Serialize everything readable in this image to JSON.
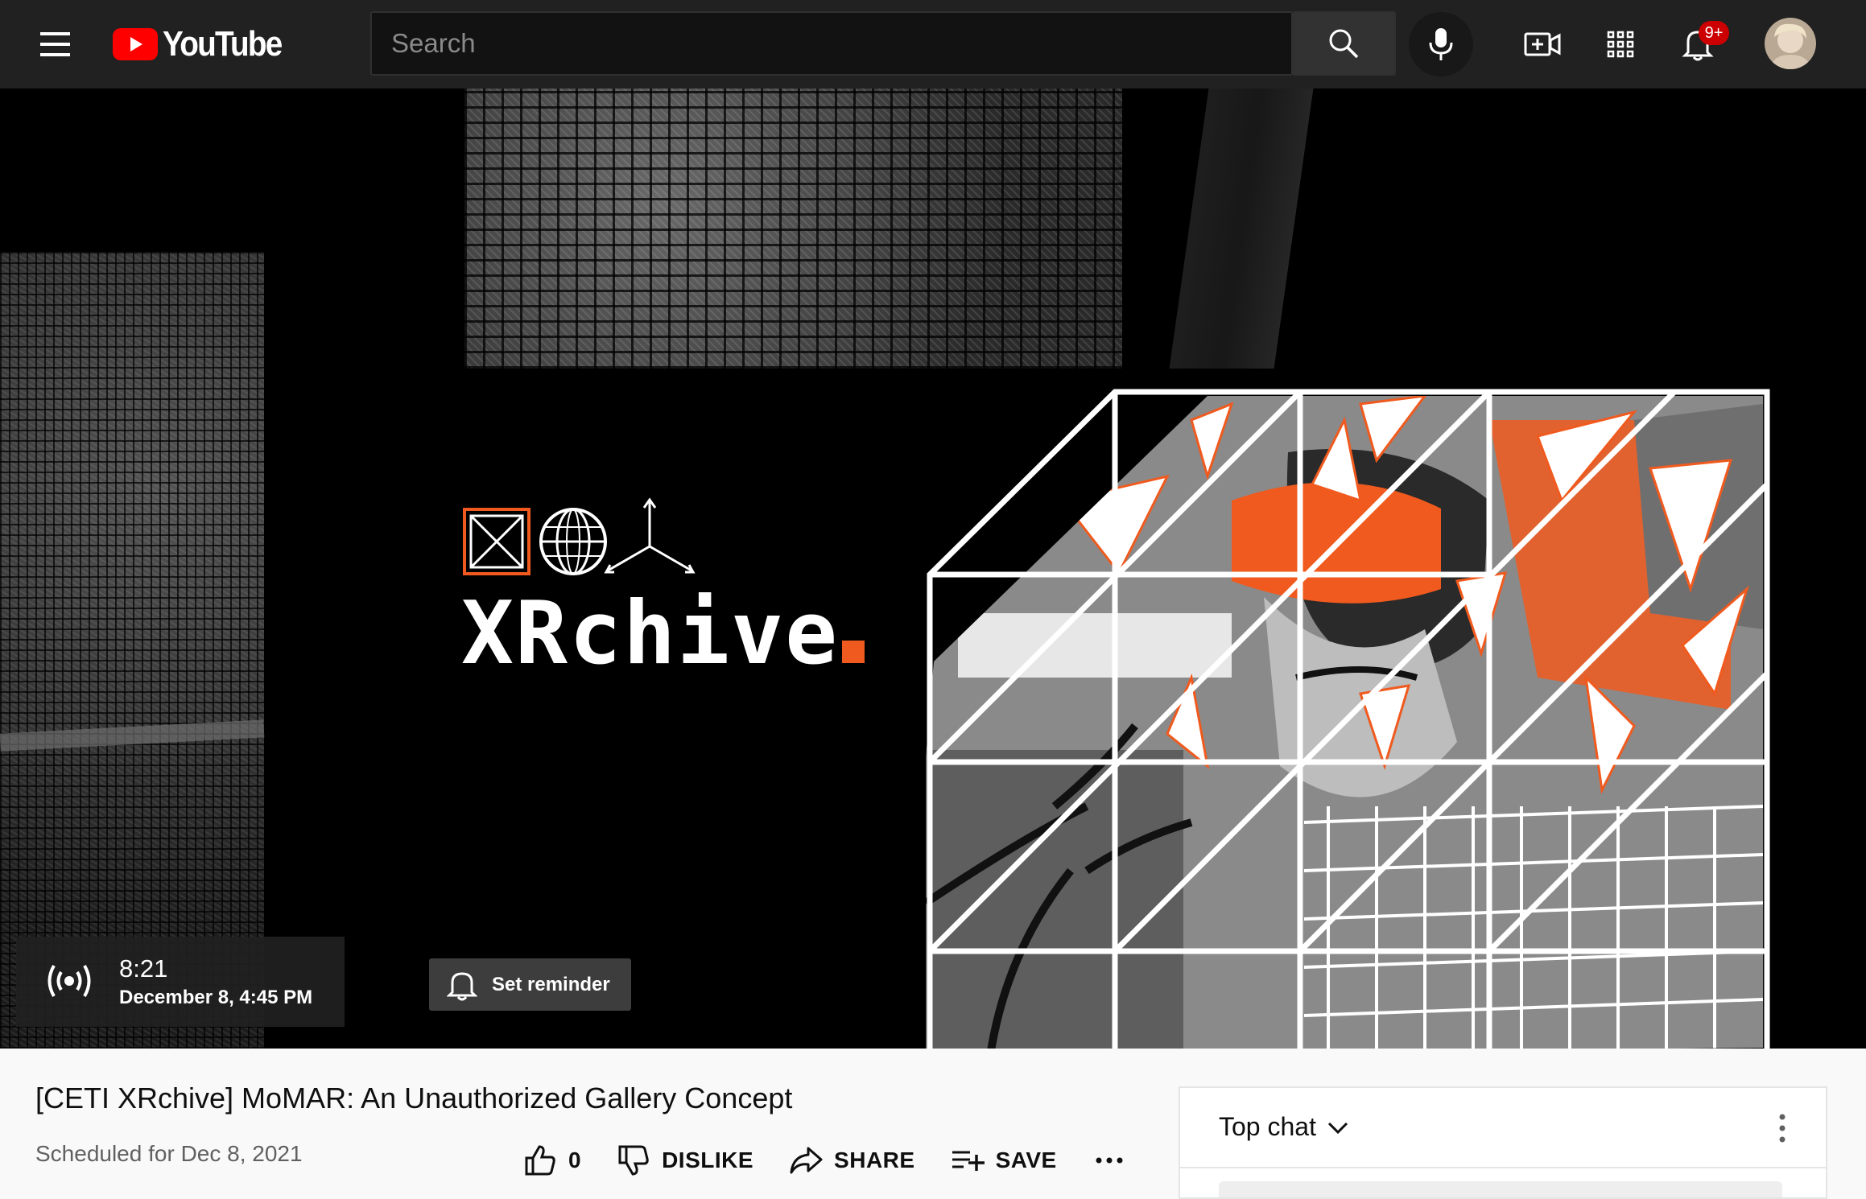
{
  "header": {
    "logo_text": "YouTube",
    "search_placeholder": "Search",
    "notifications_badge": "9+"
  },
  "icons": {
    "menu": "hamburger-menu-icon",
    "search": "search-icon",
    "mic": "microphone-icon",
    "create": "video-camera-plus-icon",
    "apps": "apps-grid-icon",
    "notifications": "bell-icon",
    "live": "live-broadcast-icon",
    "like": "thumbs-up-icon",
    "dislike": "thumbs-down-icon",
    "share": "share-arrow-icon",
    "save": "playlist-add-icon",
    "more": "more-horizontal-icon"
  },
  "video": {
    "artwork_title": "XRchive",
    "live_time": "8:21",
    "live_date": "December 8, 4:45 PM",
    "reminder_label": "Set reminder"
  },
  "details": {
    "title": "[CETI XRchive] MoMAR: An Unauthorized Gallery Concept",
    "scheduled": "Scheduled for Dec 8, 2021",
    "like_count": "0",
    "dislike_label": "DISLIKE",
    "share_label": "SHARE",
    "save_label": "SAVE"
  },
  "chat": {
    "title": "Top chat"
  },
  "colors": {
    "topbar": "#212121",
    "brand_red": "#ff0000",
    "accent_orange": "#f05a1e",
    "page_bg": "#f9f9f9"
  }
}
